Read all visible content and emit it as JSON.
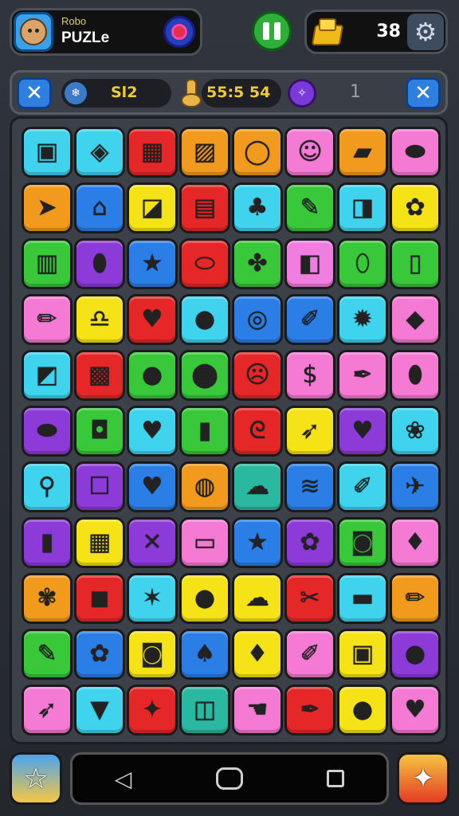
{
  "header": {
    "profile_subtitle": "Robo",
    "profile_title": "PUZLe",
    "coin_count": "38"
  },
  "infobar": {
    "level_text": "Sl2",
    "timer_text": "55:5 54",
    "moves_text": "1"
  },
  "colors": {
    "pink": "#f47ad4",
    "cyan": "#3fd3ee",
    "red": "#e52727",
    "orange": "#f29a1d",
    "yellow": "#f5e318",
    "magenta": "#f07ee0",
    "green": "#38c83a",
    "blue": "#2a7ee6",
    "purple": "#8c3ad8",
    "teal": "#2ab8a0"
  },
  "board": {
    "rows": [
      [
        {
          "color": "cyan",
          "icon": "card-icon",
          "glyph": "▣"
        },
        {
          "color": "cyan",
          "icon": "box-icon",
          "glyph": "◈"
        },
        {
          "color": "red",
          "icon": "building-icon",
          "glyph": "▦"
        },
        {
          "color": "orange",
          "icon": "note-icon",
          "glyph": "▨"
        },
        {
          "color": "orange",
          "icon": "mirror-icon",
          "glyph": "◯"
        },
        {
          "color": "pink",
          "icon": "smiley-icon",
          "glyph": "☺"
        },
        {
          "color": "orange",
          "icon": "eraser-icon",
          "glyph": "▰"
        },
        {
          "color": "pink",
          "icon": "dish-icon",
          "glyph": "⬬"
        }
      ],
      [
        {
          "color": "orange",
          "icon": "plane-icon",
          "glyph": "➤"
        },
        {
          "color": "blue",
          "icon": "house-icon",
          "glyph": "⌂"
        },
        {
          "color": "yellow",
          "icon": "bag-icon",
          "glyph": "◪"
        },
        {
          "color": "red",
          "icon": "scroll-icon",
          "glyph": "▤"
        },
        {
          "color": "cyan",
          "icon": "plant-icon",
          "glyph": "♣"
        },
        {
          "color": "green",
          "icon": "brush-icon",
          "glyph": "✎"
        },
        {
          "color": "cyan",
          "icon": "cup-icon",
          "glyph": "◨"
        },
        {
          "color": "yellow",
          "icon": "flower-icon",
          "glyph": "✿"
        }
      ],
      [
        {
          "color": "green",
          "icon": "clipboard-icon",
          "glyph": "▥"
        },
        {
          "color": "purple",
          "icon": "lemon-icon",
          "glyph": "⬮"
        },
        {
          "color": "blue",
          "icon": "star-icon",
          "glyph": "★"
        },
        {
          "color": "red",
          "icon": "bread-icon",
          "glyph": "⬭"
        },
        {
          "color": "green",
          "icon": "puzzle-icon",
          "glyph": "✤"
        },
        {
          "color": "magenta",
          "icon": "jar-icon",
          "glyph": "◧"
        },
        {
          "color": "green",
          "icon": "eggplant-icon",
          "glyph": "⬯"
        },
        {
          "color": "green",
          "icon": "phone-icon",
          "glyph": "▯"
        }
      ],
      [
        {
          "color": "pink",
          "icon": "pencil-icon",
          "glyph": "✏"
        },
        {
          "color": "yellow",
          "icon": "bell-icon",
          "glyph": "♎"
        },
        {
          "color": "red",
          "icon": "heart-icon",
          "glyph": "♥"
        },
        {
          "color": "cyan",
          "icon": "apple-icon",
          "glyph": "●"
        },
        {
          "color": "blue",
          "icon": "donut-icon",
          "glyph": "◎"
        },
        {
          "color": "blue",
          "icon": "crayon-icon",
          "glyph": "✐"
        },
        {
          "color": "cyan",
          "icon": "splat-icon",
          "glyph": "✹"
        },
        {
          "color": "pink",
          "icon": "cube-icon",
          "glyph": "◆"
        }
      ],
      [
        {
          "color": "cyan",
          "icon": "bucket-icon",
          "glyph": "◩"
        },
        {
          "color": "red",
          "icon": "radio-icon",
          "glyph": "▩"
        },
        {
          "color": "green",
          "icon": "orange-icon",
          "glyph": "●"
        },
        {
          "color": "green",
          "icon": "melon-icon",
          "glyph": "⬤"
        },
        {
          "color": "red",
          "icon": "face-icon",
          "glyph": "☹"
        },
        {
          "color": "pink",
          "icon": "dollar-icon",
          "glyph": "$"
        },
        {
          "color": "pink",
          "icon": "pin-icon",
          "glyph": "✒"
        },
        {
          "color": "pink",
          "icon": "lemon-icon",
          "glyph": "⬮"
        }
      ],
      [
        {
          "color": "purple",
          "icon": "football-icon",
          "glyph": "⬬"
        },
        {
          "color": "green",
          "icon": "bottle-icon",
          "glyph": "◘"
        },
        {
          "color": "cyan",
          "icon": "heart-icon",
          "glyph": "♥"
        },
        {
          "color": "green",
          "icon": "lipstick-icon",
          "glyph": "▮"
        },
        {
          "color": "red",
          "icon": "ribbon-icon",
          "glyph": "ᘓ"
        },
        {
          "color": "yellow",
          "icon": "carrot-icon",
          "glyph": "➶"
        },
        {
          "color": "purple",
          "icon": "heart-icon",
          "glyph": "♥"
        },
        {
          "color": "cyan",
          "icon": "grapes-icon",
          "glyph": "❀"
        }
      ],
      [
        {
          "color": "cyan",
          "icon": "magnifier-icon",
          "glyph": "⚲"
        },
        {
          "color": "purple",
          "icon": "robot-icon",
          "glyph": "☐"
        },
        {
          "color": "blue",
          "icon": "heart-icon",
          "glyph": "♥"
        },
        {
          "color": "orange",
          "icon": "ring-icon",
          "glyph": "◍"
        },
        {
          "color": "teal",
          "icon": "cloud-icon",
          "glyph": "☁"
        },
        {
          "color": "blue",
          "icon": "bacon-icon",
          "glyph": "≋"
        },
        {
          "color": "cyan",
          "icon": "crayon-icon",
          "glyph": "✐"
        },
        {
          "color": "blue",
          "icon": "rocket-icon",
          "glyph": "✈"
        }
      ],
      [
        {
          "color": "purple",
          "icon": "book-icon",
          "glyph": "▮"
        },
        {
          "color": "yellow",
          "icon": "picture-icon",
          "glyph": "▦"
        },
        {
          "color": "purple",
          "icon": "tools-icon",
          "glyph": "✕"
        },
        {
          "color": "pink",
          "icon": "tube-icon",
          "glyph": "▭"
        },
        {
          "color": "blue",
          "icon": "star-icon",
          "glyph": "★"
        },
        {
          "color": "purple",
          "icon": "cloud-icon",
          "glyph": "✿"
        },
        {
          "color": "green",
          "icon": "lantern-icon",
          "glyph": "◙"
        },
        {
          "color": "pink",
          "icon": "pepper-icon",
          "glyph": "♦"
        }
      ],
      [
        {
          "color": "orange",
          "icon": "leaf-icon",
          "glyph": "✾"
        },
        {
          "color": "red",
          "icon": "camera-icon",
          "glyph": "◼"
        },
        {
          "color": "cyan",
          "icon": "starfish-icon",
          "glyph": "✶"
        },
        {
          "color": "yellow",
          "icon": "apple-icon",
          "glyph": "●"
        },
        {
          "color": "yellow",
          "icon": "cloud-icon",
          "glyph": "☁"
        },
        {
          "color": "red",
          "icon": "scissors-icon",
          "glyph": "✂"
        },
        {
          "color": "cyan",
          "icon": "battery-icon",
          "glyph": "▬"
        },
        {
          "color": "orange",
          "icon": "marker-icon",
          "glyph": "✏"
        }
      ],
      [
        {
          "color": "green",
          "icon": "knife-icon",
          "glyph": "✎"
        },
        {
          "color": "blue",
          "icon": "flower-icon",
          "glyph": "✿"
        },
        {
          "color": "yellow",
          "icon": "pot-icon",
          "glyph": "◙"
        },
        {
          "color": "blue",
          "icon": "pear-icon",
          "glyph": "♠"
        },
        {
          "color": "yellow",
          "icon": "drop-icon",
          "glyph": "♦"
        },
        {
          "color": "pink",
          "icon": "bottle-icon",
          "glyph": "✐"
        },
        {
          "color": "yellow",
          "icon": "box-icon",
          "glyph": "▣"
        },
        {
          "color": "purple",
          "icon": "apple-icon",
          "glyph": "●"
        }
      ],
      [
        {
          "color": "pink",
          "icon": "carrot-icon",
          "glyph": "➶"
        },
        {
          "color": "cyan",
          "icon": "icecream-icon",
          "glyph": "▼"
        },
        {
          "color": "red",
          "icon": "bird-icon",
          "glyph": "✦"
        },
        {
          "color": "teal",
          "icon": "can-icon",
          "glyph": "◫"
        },
        {
          "color": "pink",
          "icon": "hand-icon",
          "glyph": "☚"
        },
        {
          "color": "red",
          "icon": "pen-icon",
          "glyph": "✒"
        },
        {
          "color": "yellow",
          "icon": "apple-icon",
          "glyph": "●"
        },
        {
          "color": "pink",
          "icon": "strawberry-icon",
          "glyph": "♥"
        }
      ]
    ]
  }
}
